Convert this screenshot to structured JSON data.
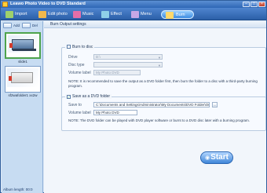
{
  "window": {
    "title": "Leawo Photo Video to DVD Standard"
  },
  "toolbar": {
    "items": [
      {
        "label": "Import"
      },
      {
        "label": "Edit photo"
      },
      {
        "label": "Music"
      },
      {
        "label": "Effect"
      },
      {
        "label": "Menu"
      },
      {
        "label": "Burn"
      }
    ]
  },
  "leftpane": {
    "btn1": "Add",
    "btn2": "Del",
    "slides": [
      {
        "label": "slide1"
      },
      {
        "label": "sf2wafolder1 xx2w"
      }
    ],
    "status": "Album length: 00:0"
  },
  "main": {
    "crumb": "Burn   Output settings",
    "dvd": {
      "title": "Burn to disc",
      "checked": true,
      "drive_label": "Drive",
      "drive_value": "D:\\",
      "type_label": "Disc type",
      "type_value": "",
      "name_label": "Volume label",
      "name_value": "My Photo DVD",
      "note": "NOTE: It is recommended to save the output as a DVD folder first, then burn the folder to a disc with a third-party burning program."
    },
    "folder": {
      "title": "Save as a DVD folder",
      "checked": true,
      "path_label": "Save to",
      "path_value": "C:\\Documents and Settings\\Administrator\\My Documents\\DVD Folder\\Output",
      "name_label": "Volume label",
      "name_value": "My Photo DVD",
      "note": "NOTE: The DVD folder can be played with DVD player software or burnt to a DVD disc later with a burning program."
    },
    "start_label": "Start"
  },
  "colors": {
    "accent": "#3f86d8",
    "titlebar": "#2f67b5",
    "panel": "#c7dcf2"
  }
}
